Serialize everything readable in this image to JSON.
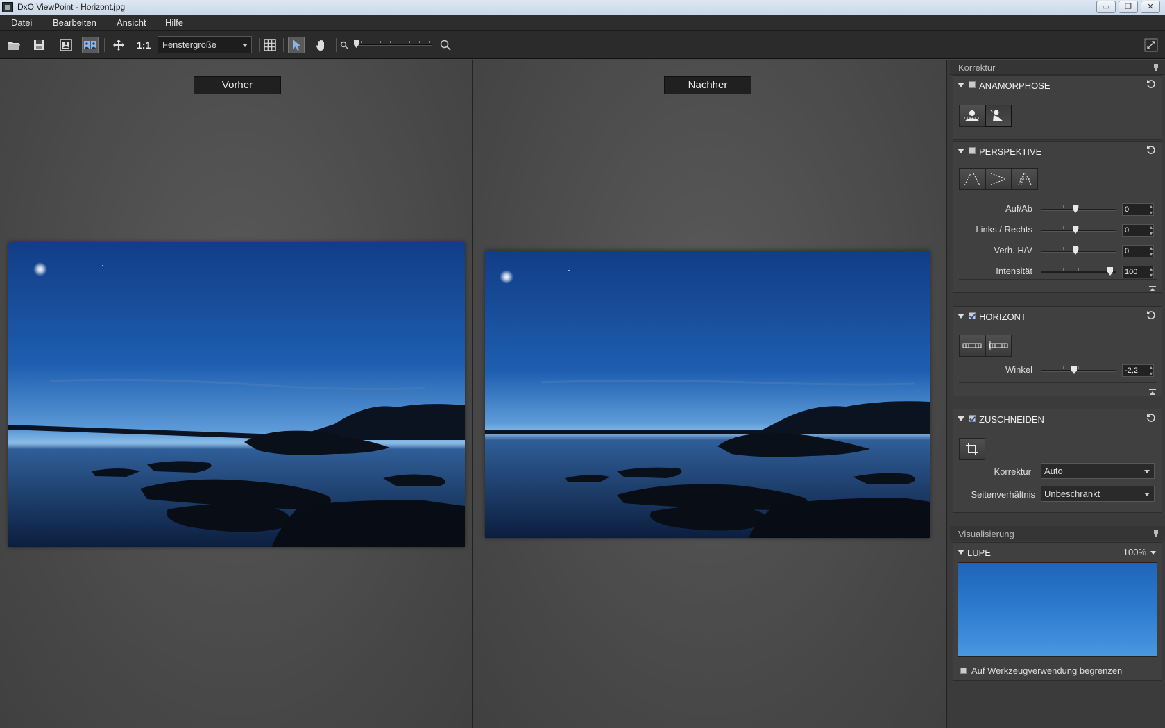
{
  "window": {
    "title": "DxO ViewPoint - Horizont.jpg",
    "minimize": "▭",
    "restore": "❐",
    "close": "✕"
  },
  "menu": [
    "Datei",
    "Bearbeiten",
    "Ansicht",
    "Hilfe"
  ],
  "toolbar": {
    "icons": [
      "open-folder-icon",
      "save-icon",
      "single-view-icon",
      "split-view-icon",
      "move-icon",
      "grid-icon",
      "pointer-icon",
      "hand-icon",
      "zoom-out-icon",
      "zoom-in-icon",
      "fullscreen-icon"
    ],
    "actual_size_label": "1:1",
    "zoom_select_value": "Fenstergröße",
    "zoom_slider_level": 0.0
  },
  "viewer": {
    "before_label": "Vorher",
    "after_label": "Nachher",
    "horizon_tilt_before_deg": -2.2
  },
  "panel": {
    "correction_header": "Korrektur",
    "anamorphose": {
      "title": "ANAMORPHOSE",
      "enabled": false,
      "tools": [
        "anamorphose-portrait-icon",
        "anamorphose-person-icon"
      ]
    },
    "perspektive": {
      "title": "PERSPEKTIVE",
      "enabled": false,
      "tools": [
        "perspective-vertical-icon",
        "perspective-horizontal-icon",
        "perspective-8point-icon"
      ],
      "sliders": [
        {
          "label": "Auf/Ab",
          "value": "0",
          "level": 0.5
        },
        {
          "label": "Links / Rechts",
          "value": "0",
          "level": 0.5
        },
        {
          "label": "Verh. H/V",
          "value": "0",
          "level": 0.5
        },
        {
          "label": "Intensität",
          "value": "100",
          "level": 1.0
        }
      ]
    },
    "horizont": {
      "title": "HORIZONT",
      "enabled": true,
      "tools": [
        "horizon-line-icon",
        "horizon-vertical-icon"
      ],
      "slider": {
        "label": "Winkel",
        "value": "-2,2",
        "level": 0.48
      }
    },
    "zuschneiden": {
      "title": "ZUSCHNEIDEN",
      "enabled": true,
      "tool": "crop-icon",
      "korrektur_label": "Korrektur",
      "korrektur_value": "Auto",
      "ratio_label": "Seitenverhältnis",
      "ratio_value": "Unbeschränkt"
    },
    "visualisierung_header": "Visualisierung",
    "lupe": {
      "title": "LUPE",
      "zoom": "100%",
      "limit_label": "Auf Werkzeugverwendung begrenzen",
      "limit_checked": false
    }
  },
  "colors": {
    "sky_top": "#0f2a5c",
    "sky_mid": "#1f5aa8",
    "sky_horizon": "#7fb3e0",
    "water": "#1a3f78",
    "silhouette": "#0a0f18"
  }
}
